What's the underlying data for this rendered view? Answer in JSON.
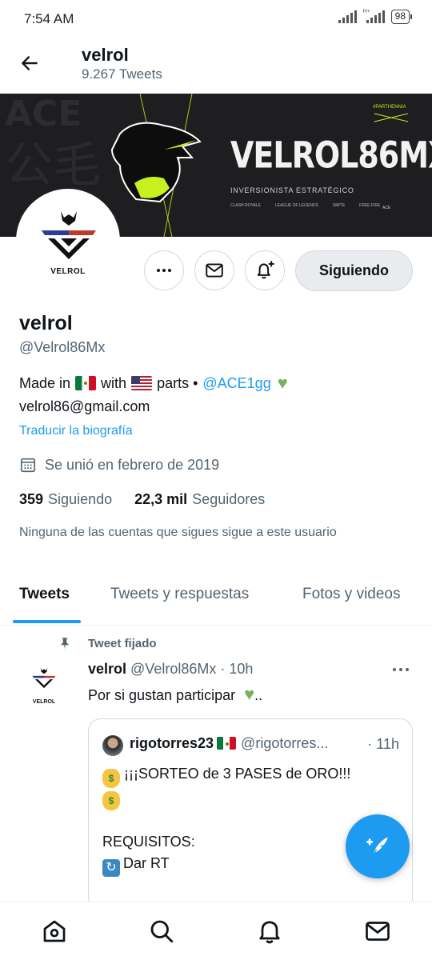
{
  "status_bar": {
    "time": "7:54 AM",
    "network_tag": "H+",
    "battery": "98"
  },
  "header": {
    "name": "velrol",
    "tweet_count": "9.267 Tweets"
  },
  "banner": {
    "title": "VELROL86MX",
    "subtitle": "INVERSIONISTA ESTRATÉGICO",
    "tag": "#PARTHENNIA",
    "game_logos": [
      "CLASH ROYALE",
      "LEAGUE OF LEGENDS",
      "SMITE",
      "FREE FIRE"
    ],
    "brand": "ACE"
  },
  "avatar": {
    "label": "VELROL"
  },
  "actions": {
    "following_label": "Siguiendo"
  },
  "profile": {
    "name": "velrol",
    "handle": "@Velrol86Mx",
    "bio_made_in": "Made in",
    "bio_with": "with",
    "bio_parts": "parts •",
    "bio_mention": "@ACE1gg",
    "bio_email": "velrol86@gmail.com",
    "translate_label": "Traducir la biografía",
    "joined": "Se unió en febrero de 2019",
    "following_count": "359",
    "following_label": "Siguiendo",
    "followers_count": "22,3 mil",
    "followers_label": "Seguidores",
    "mutual_note": "Ninguna de las cuentas que sigues sigue a este usuario"
  },
  "tabs": [
    {
      "label": "Tweets"
    },
    {
      "label": "Tweets y respuestas"
    },
    {
      "label": "Fotos y videos"
    }
  ],
  "pinned_tweet": {
    "pinned_label": "Tweet fijado",
    "avatar_label": "VELROL",
    "author": "velrol",
    "meta": "@Velrol86Mx · 10h",
    "text": "Por si gustan participar",
    "text_tail": "..",
    "quote": {
      "author": "rigotorres23",
      "handle": "@rigotorres...",
      "time": "· 11h",
      "line1": "¡¡¡SORTEO de 3 PASES de ORO!!!",
      "line3": "REQUISITOS:",
      "line4": "Dar RT"
    }
  },
  "icons": {
    "accent": "#1d9bf0",
    "nav": [
      "home-icon",
      "search-icon",
      "notifications-icon",
      "messages-icon"
    ]
  }
}
